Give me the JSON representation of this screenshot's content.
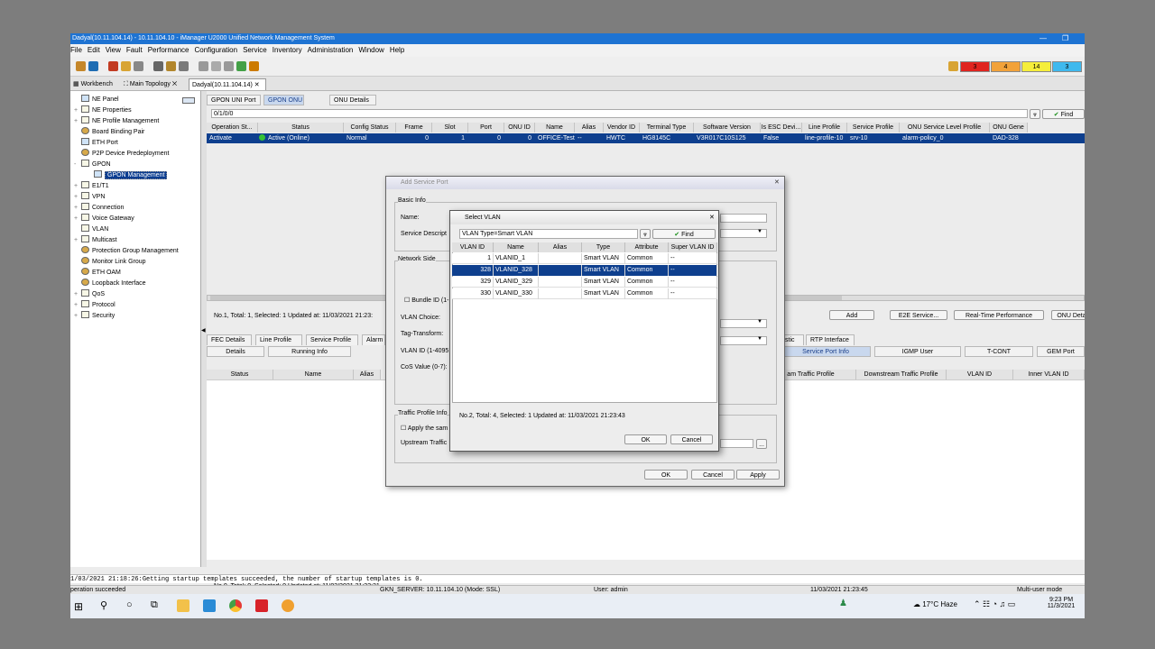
{
  "window": {
    "title": "Dadyal(10.11.104.14) - 10.11.104.10 - iManager U2000 Unified Network Management System",
    "min": "—",
    "max": "❐",
    "close": "✕"
  },
  "menu": [
    "File",
    "Edit",
    "View",
    "Fault",
    "Performance",
    "Configuration",
    "Service",
    "Inventory",
    "Administration",
    "Window",
    "Help"
  ],
  "alarms": [
    {
      "count": "3",
      "color": "#e0241f"
    },
    {
      "count": "4",
      "color": "#f2a23a"
    },
    {
      "count": "14",
      "color": "#f5ee3b"
    },
    {
      "count": "3",
      "color": "#3fb9ee"
    }
  ],
  "tabs": [
    {
      "label": "Workbench"
    },
    {
      "label": "Main Topology"
    },
    {
      "label": "Dadyal(10.11.104.14)"
    }
  ],
  "tree": [
    {
      "label": "NE Panel",
      "icon": "n",
      "exp": ""
    },
    {
      "label": "NE Properties",
      "icon": "",
      "exp": "+"
    },
    {
      "label": "NE Profile Management",
      "icon": "",
      "exp": "+"
    },
    {
      "label": "Board Binding Pair",
      "icon": "g",
      "exp": ""
    },
    {
      "label": "ETH Port",
      "icon": "n",
      "exp": ""
    },
    {
      "label": "P2P Device Predeployment",
      "icon": "g",
      "exp": ""
    },
    {
      "label": "GPON",
      "icon": "",
      "exp": "-"
    },
    {
      "label": "GPON Management",
      "icon": "n",
      "exp": "",
      "selected": true
    },
    {
      "label": "E1/T1",
      "icon": "",
      "exp": "+"
    },
    {
      "label": "VPN",
      "icon": "",
      "exp": "+"
    },
    {
      "label": "Connection",
      "icon": "",
      "exp": "+"
    },
    {
      "label": "Voice Gateway",
      "icon": "",
      "exp": "+"
    },
    {
      "label": "VLAN",
      "icon": "",
      "exp": ""
    },
    {
      "label": "Multicast",
      "icon": "",
      "exp": "+"
    },
    {
      "label": "Protection Group Management",
      "icon": "g",
      "exp": ""
    },
    {
      "label": "Monitor Link Group",
      "icon": "g",
      "exp": ""
    },
    {
      "label": "ETH OAM",
      "icon": "g",
      "exp": ""
    },
    {
      "label": "Loopback Interface",
      "icon": "g",
      "exp": ""
    },
    {
      "label": "QoS",
      "icon": "",
      "exp": "+"
    },
    {
      "label": "Protocol",
      "icon": "",
      "exp": "+"
    },
    {
      "label": "Security",
      "icon": "",
      "exp": "+"
    }
  ],
  "gpon": {
    "subtabs": [
      "GPON UNI Port",
      "GPON ONU",
      "ONU Details"
    ],
    "path": "0/1/0/0",
    "find": "Find",
    "columns": [
      "Operation St...",
      "Status",
      "Config Status",
      "Frame",
      "Slot",
      "Port",
      "ONU ID",
      "Name",
      "Alias",
      "Vendor ID",
      "Terminal Type",
      "Software Version",
      "Is ESC Devi...",
      "Line Profile",
      "Service Profile",
      "ONU Service Level Profile",
      "ONU Gene"
    ],
    "row": [
      "Activate",
      "Active (Online)",
      "Normal",
      "0",
      "1",
      "0",
      "0",
      "OFFICE-Test",
      "--",
      "HWTC",
      "HG8145C",
      "V3R017C10S125",
      "False",
      "line-profile-10",
      "srv-10",
      "alarm-policy_0",
      "DAD-328"
    ],
    "status": "No.1, Total: 1, Selected: 1   Updated at: 11/03/2021 21:23:",
    "buttons": [
      "Add",
      "E2E Service...",
      "Real-Time Performance",
      "ONU Deta"
    ],
    "bottomtabs": [
      "FEC Details",
      "Line Profile",
      "Service Profile",
      "Alarm",
      "stic",
      "RTP Interface"
    ],
    "bottomtabs2": [
      "Details",
      "Running Info",
      "Service Port Info",
      "IGMP User",
      "T-CONT",
      "GEM Port"
    ],
    "portcols": [
      "Status",
      "Name",
      "Alias",
      "am Traffic Profile",
      "Downstream Traffic Profile",
      "VLAN ID",
      "Inner VLAN ID"
    ],
    "status2": "No.0, Total: 0, Selected: 0   Updated at: 11/03/2021 21:23:31"
  },
  "log": "1/03/2021 21:18:26:Getting startup templates succeeded, the number of startup templates is 0.",
  "statusbar": {
    "msg": "peration succeeded",
    "server": "GKN_SERVER: 10.11.104.10 (Mode: SSL)",
    "user": "User: admin",
    "time": "11/03/2021 21:23:45",
    "mode": "Multi-user mode"
  },
  "addPort": {
    "title": "Add Service Port",
    "basic": "Basic Info",
    "name": "Name:",
    "desc": "Service Descript",
    "network": "Network Side",
    "bundle": "Bundle ID (1-",
    "vchoice": "VLAN Choice:",
    "tag": "Tag-Transform:",
    "vid": "VLAN ID (1-4095",
    "cos": "CoS Value (0-7):",
    "traffic": "Traffic Profile Info",
    "apply": "Apply the sam",
    "up": "Upstream Traffic",
    "ok": "OK",
    "cancel": "Cancel",
    "applybtn": "Apply"
  },
  "selectVlan": {
    "title": "Select VLAN",
    "filter": "VLAN Type=Smart VLAN",
    "find": "Find",
    "columns": [
      "VLAN ID",
      "Name",
      "Alias",
      "Type",
      "Attribute",
      "Super VLAN ID"
    ],
    "rows": [
      {
        "id": "1",
        "name": "VLANID_1",
        "alias": "",
        "type": "Smart VLAN",
        "attr": "Common",
        "super": "--"
      },
      {
        "id": "328",
        "name": "VLANID_328",
        "alias": "",
        "type": "Smart VLAN",
        "attr": "Common",
        "super": "--",
        "selected": true
      },
      {
        "id": "329",
        "name": "VLANID_329",
        "alias": "",
        "type": "Smart VLAN",
        "attr": "Common",
        "super": "--"
      },
      {
        "id": "330",
        "name": "VLANID_330",
        "alias": "",
        "type": "Smart VLAN",
        "attr": "Common",
        "super": "--"
      }
    ],
    "status": "No.2, Total: 4, Selected: 1   Updated at: 11/03/2021 21:23:43",
    "ok": "OK",
    "cancel": "Cancel"
  },
  "taskbar": {
    "weather": "17°C  Haze",
    "time": "9:23 PM",
    "date": "11/3/2021"
  }
}
